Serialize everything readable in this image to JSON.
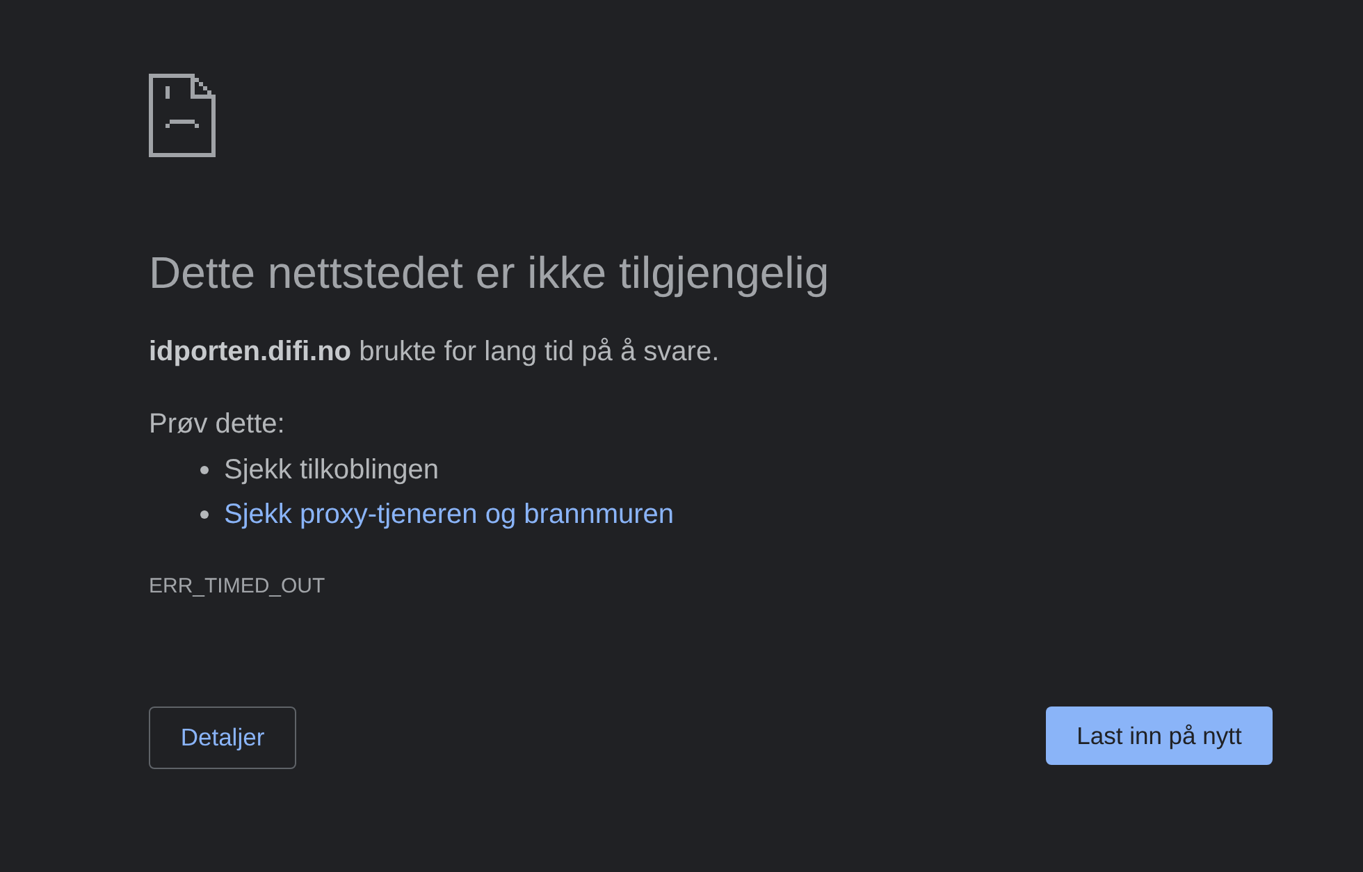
{
  "title": "Dette nettstedet er ikke tilgjengelig",
  "summary": "**idporten.difi.no** brukte for lang tid på å svare.",
  "suggestions": {
    "heading": "Prøv dette:",
    "items": [
      {
        "text": "Sjekk tilkoblingen",
        "kind": "text"
      },
      {
        "text": "Sjekk proxy-tjeneren og brannmuren",
        "kind": "link"
      }
    ]
  },
  "error_code": "ERR_TIMED_OUT",
  "buttons": [
    {
      "label": "Detaljer",
      "kind": "secondary"
    },
    {
      "label": "Last inn på nytt",
      "kind": "primary"
    }
  ]
}
